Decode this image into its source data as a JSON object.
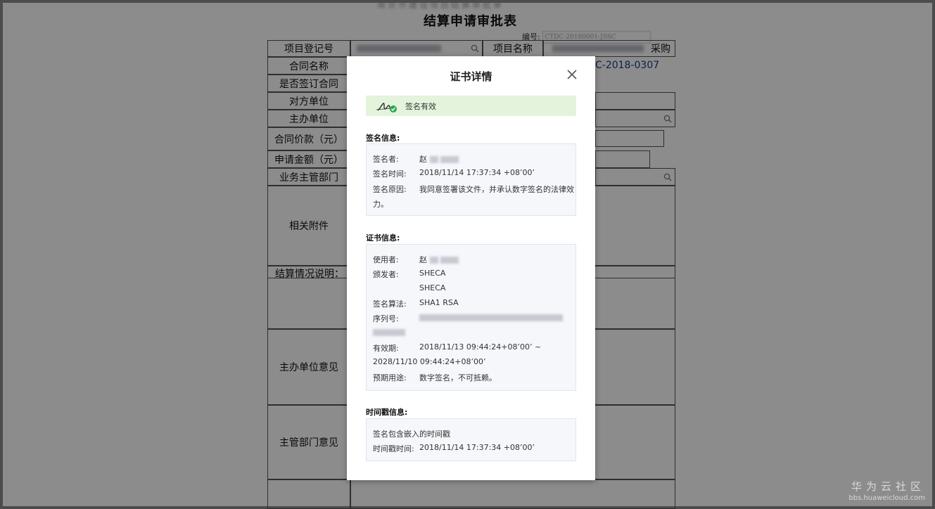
{
  "document": {
    "header_blurred": "南京市建设项目结算审批单",
    "title": "结算申请审批表",
    "number_label": "编号:",
    "number_value": "CTDC-20180001-JSSC",
    "rows": [
      {
        "label": "项目登记号"
      },
      {
        "label": "合同名称"
      },
      {
        "label": "是否签订合同"
      },
      {
        "label": "对方单位"
      },
      {
        "label": "主办单位"
      },
      {
        "label": "合同价款（元）"
      },
      {
        "label": "申请金额（元）"
      },
      {
        "label": "业务主管部门"
      },
      {
        "label": "相关附件"
      },
      {
        "label": "结算情况说明："
      },
      {
        "label": "主办单位意见"
      },
      {
        "label": "主管部门意见"
      }
    ],
    "project_name_label": "项目名称",
    "project_name_suffix": "采购",
    "contract_code": "C-2018-0307"
  },
  "modal": {
    "title": "证书详情",
    "close_icon": "close-icon",
    "status_icon": "signature-valid-icon",
    "status_text": "签名有效",
    "signature_section": {
      "title": "签名信息:",
      "signer_label": "签名者:",
      "signer_value": "赵",
      "time_label": "签名时间:",
      "time_value": "2018/11/14 17:37:34 +08’00’",
      "reason_label": "签名原因:",
      "reason_value_line1": "我同意签署该文件，并承认数字签名的法律效",
      "reason_value_line2": "力。"
    },
    "certificate_section": {
      "title": "证书信息:",
      "user_label": "使用者:",
      "user_value": "赵",
      "issuer_label": "颁发者:",
      "issuer_value_1": "SHECA",
      "issuer_value_2": "SHECA",
      "algo_label": "签名算法:",
      "algo_value": "SHA1 RSA",
      "serial_label": "序列号:",
      "validity_label": "有效期:",
      "validity_value_line1": "2018/11/13 09:44:24+08’00’ ~",
      "validity_value_line2": "2028/11/10 09:44:24+08’00’",
      "usage_label": "预期用途:",
      "usage_value": "数字签名，不可抵赖。"
    },
    "timestamp_section": {
      "title": "时间戳信息:",
      "embedded_text": "签名包含嵌入的时间戳",
      "ts_label": "时间戳时间:",
      "ts_value": "2018/11/14 17:37:34 +08’00’"
    }
  },
  "watermark": {
    "brand": "华为云社区",
    "url": "bbs.huaweicloud.com"
  },
  "colors": {
    "status_bg": "#e3f3dc",
    "valid_green": "#2aa84a",
    "section_bg": "#f5f7fb",
    "contract_code_blue": "#1e3a8a"
  }
}
